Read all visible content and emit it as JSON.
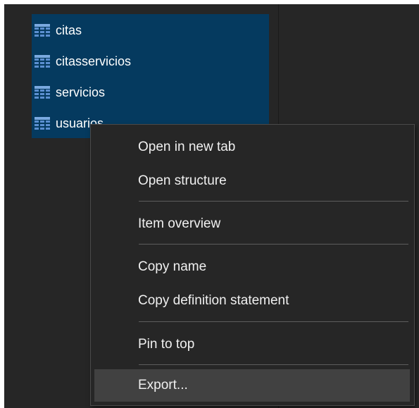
{
  "tree": {
    "items": [
      {
        "label": "citas"
      },
      {
        "label": "citasservicios"
      },
      {
        "label": "servicios"
      },
      {
        "label": "usuarios"
      }
    ]
  },
  "context_menu": {
    "items": [
      {
        "label": "Open in new tab"
      },
      {
        "label": "Open structure"
      },
      {
        "label": "Item overview"
      },
      {
        "label": "Copy name"
      },
      {
        "label": "Copy definition statement"
      },
      {
        "label": "Pin to top"
      },
      {
        "label": "Export..."
      }
    ],
    "highlighted_item": "Export..."
  },
  "colors": {
    "background": "#262626",
    "selection": "#053a5f",
    "menu_hover": "#414141",
    "table_icon": "#5b8fd0",
    "text": "#f0f0f0"
  },
  "icons": {
    "table": "table-grid-icon"
  }
}
